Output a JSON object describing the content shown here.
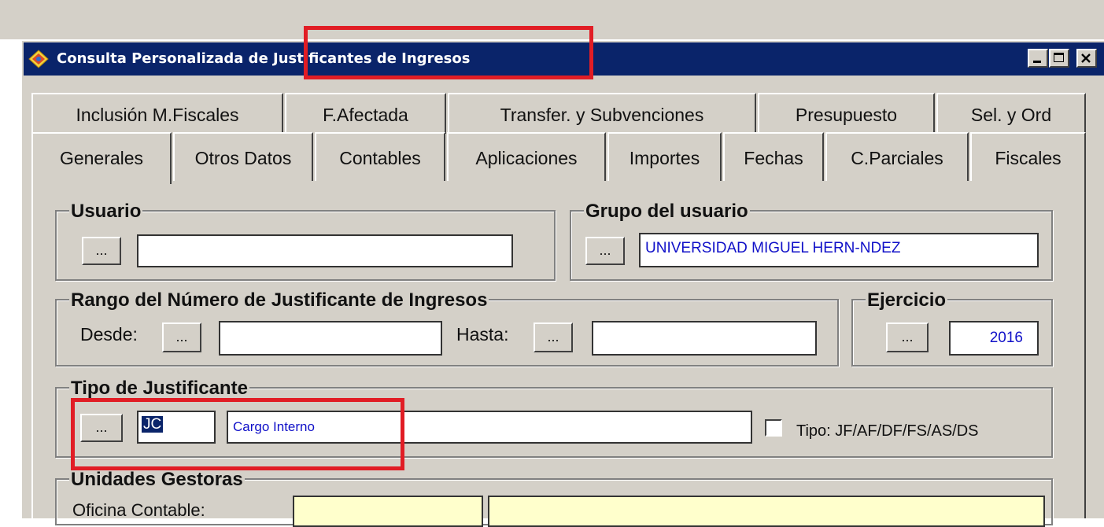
{
  "window": {
    "title": "Consulta Personalizada de Justificantes de Ingresos",
    "controls": [
      "minimize",
      "maximize",
      "close"
    ]
  },
  "tabs_row1": [
    "Inclusión M.Fiscales",
    "F.Afectada",
    "Transfer. y Subvenciones",
    "Presupuesto",
    "Sel. y Ord"
  ],
  "tabs_row2": [
    "Generales",
    "Otros Datos",
    "Contables",
    "Aplicaciones",
    "Importes",
    "Fechas",
    "C.Parciales",
    "Fiscales"
  ],
  "usuario": {
    "label": "Usuario",
    "button": "...",
    "value": ""
  },
  "grupo": {
    "label": "Grupo del usuario",
    "button": "...",
    "value": "UNIVERSIDAD MIGUEL HERN-NDEZ"
  },
  "rango": {
    "label": "Rango del Número de Justificante de Ingresos",
    "desde_label": "Desde:",
    "hasta_label": "Hasta:",
    "button": "...",
    "desde_value": "",
    "hasta_value": ""
  },
  "ejercicio": {
    "label": "Ejercicio",
    "button": "...",
    "value": "2016"
  },
  "tipo": {
    "label": "Tipo de Justificante",
    "button": "...",
    "code": "JC",
    "description": "Cargo Interno",
    "checkbox_label": "Tipo: JF/AF/DF/FS/AS/DS",
    "checkbox_checked": false
  },
  "unidades": {
    "label": "Unidades Gestoras",
    "oficina_label": "Oficina Contable:",
    "oficina_code": "",
    "oficina_desc": ""
  },
  "colors": {
    "titlebar": "#0a246a",
    "face": "#d4d0c8",
    "highlight_annotation": "#e11d25",
    "field_text": "#1010c8",
    "unidades_field_bg": "#ffffcc"
  }
}
